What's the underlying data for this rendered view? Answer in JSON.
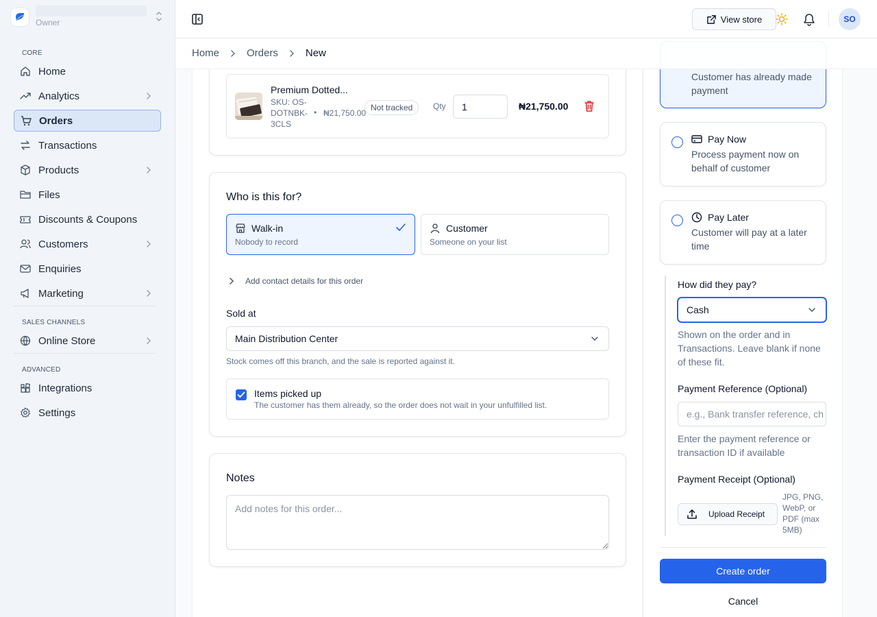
{
  "sidebar": {
    "store_role": "Owner",
    "sections": {
      "core": "CORE",
      "sales_channels": "SALES CHANNELS",
      "advanced": "ADVANCED"
    },
    "items": {
      "home": "Home",
      "analytics": "Analytics",
      "orders": "Orders",
      "transactions": "Transactions",
      "products": "Products",
      "files": "Files",
      "discounts": "Discounts & Coupons",
      "customers": "Customers",
      "enquiries": "Enquiries",
      "marketing": "Marketing",
      "online_store": "Online Store",
      "integrations": "Integrations",
      "settings": "Settings"
    },
    "active_item": "orders"
  },
  "topbar": {
    "view_store_label": "View store",
    "avatar_initials": "SO"
  },
  "breadcrumb": [
    "Home",
    "Orders",
    "New"
  ],
  "product": {
    "name": "Premium Dotted...",
    "sku": "SKU: OS-DOTNBK-3CLS",
    "unit_price": "₦21,750.00",
    "tracking_badge": "Not tracked",
    "qty_label": "Qty",
    "qty_value": "1",
    "line_total": "₦21,750.00"
  },
  "who": {
    "title": "Who is this for?",
    "walkin": {
      "title": "Walk-in",
      "subtitle": "Nobody to record",
      "selected": true
    },
    "customer": {
      "title": "Customer",
      "subtitle": "Someone on your list",
      "selected": false
    },
    "add_contact": "Add contact details for this order",
    "sold_at_label": "Sold at",
    "sold_at_value": "Main Distribution Center",
    "sold_at_hint": "Stock comes off this branch, and the sale is reported against it.",
    "pickup": {
      "checked": true,
      "title": "Items picked up",
      "subtitle": "The customer has them already, so the order does not wait in your unfulfilled list."
    }
  },
  "notes": {
    "title": "Notes",
    "placeholder": "Add notes for this order..."
  },
  "payment": {
    "paid_option_sub": "Customer has already made payment",
    "pay_now": {
      "title": "Pay Now",
      "subtitle": "Process payment now on behalf of customer"
    },
    "pay_later": {
      "title": "Pay Later",
      "subtitle": "Customer will pay at a later time"
    },
    "method_label": "How did they pay?",
    "method_value": "Cash",
    "method_hint": "Shown on the order and in Transactions. Leave blank if none of these fit.",
    "reference_label": "Payment Reference (Optional)",
    "reference_placeholder": "e.g., Bank transfer reference, ch",
    "reference_hint": "Enter the payment reference or transaction ID if available",
    "receipt_label": "Payment Receipt (Optional)",
    "upload_label": "Upload Receipt",
    "upload_note": "JPG, PNG, WebP, or PDF (max 5MB)",
    "create_label": "Create order",
    "cancel_label": "Cancel"
  },
  "colors": {
    "accent": "#2563eb",
    "danger": "#dc2626",
    "selected_bg": "#eff5ff"
  }
}
